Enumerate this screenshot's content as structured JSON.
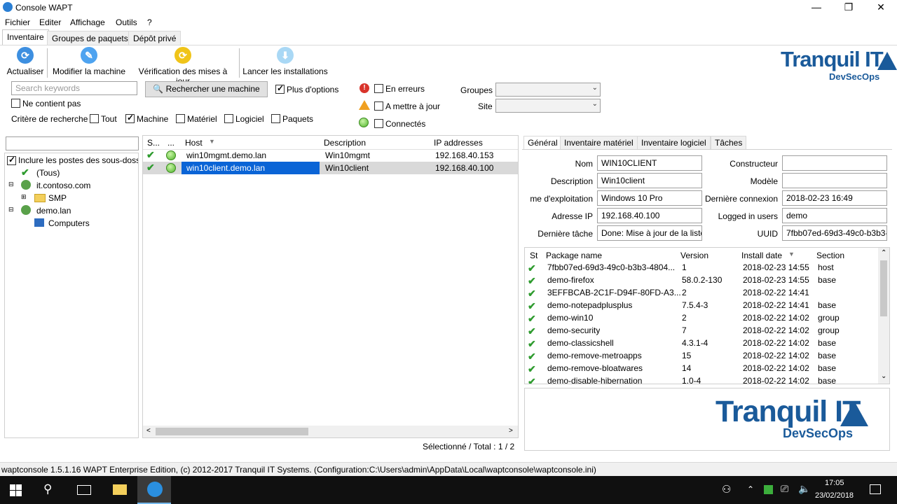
{
  "window": {
    "title": "Console WAPT"
  },
  "menu": [
    "Fichier",
    "Editer",
    "Affichage",
    "Outils",
    "?"
  ],
  "tabs": [
    "Inventaire",
    "Groupes de paquets",
    "Dépôt privé"
  ],
  "toolbar": {
    "refresh": "Actualiser",
    "edit_machine": "Modifier la machine",
    "check_updates": "Vérification des mises à jour",
    "launch_installs": "Lancer les installations"
  },
  "logo": {
    "name": "Tranquil IT",
    "tagline": "DevSecOps"
  },
  "search": {
    "placeholder": "Search keywords",
    "button": "Rechercher une machine",
    "more_options": "Plus d'options",
    "not_contains": "Ne contient pas",
    "criteria_label": "Critère de recherche",
    "criteria": [
      {
        "label": "Tout",
        "checked": false
      },
      {
        "label": "Machine",
        "checked": true
      },
      {
        "label": "Matériel",
        "checked": false
      },
      {
        "label": "Logiciel",
        "checked": false
      },
      {
        "label": "Paquets",
        "checked": false
      }
    ]
  },
  "filters": {
    "errors": "En erreurs",
    "to_update": "A mettre à jour",
    "connected": "Connectés",
    "groups_label": "Groupes",
    "site_label": "Site"
  },
  "tree": {
    "include_label": "Inclure les postes des sous-dossiers",
    "items": [
      "(Tous)",
      "it.contoso.com",
      "SMP",
      "demo.lan",
      "Computers"
    ]
  },
  "hosts": {
    "columns": [
      "S...",
      "...",
      "Host",
      "Description",
      "IP addresses"
    ],
    "rows": [
      {
        "host": "win10mgmt.demo.lan",
        "description": "Win10mgmt",
        "ip": "192.168.40.153"
      },
      {
        "host": "win10client.demo.lan",
        "description": "Win10client",
        "ip": "192.168.40.100"
      }
    ],
    "footer": "Sélectionné / Total : 1 / 2"
  },
  "detail_tabs": [
    "Général",
    "Inventaire matériel",
    "Inventaire logiciel",
    "Tâches"
  ],
  "general": {
    "nom_label": "Nom",
    "nom": "WIN10CLIENT",
    "description_label": "Description",
    "description": "Win10client",
    "os_label": "me d'exploitation",
    "os": "Windows 10 Pro",
    "ip_label": "Adresse IP",
    "ip": "192.168.40.100",
    "last_task_label": "Dernière tâche",
    "last_task": "Done: Mise à jour de la liste",
    "constructor_label": "Constructeur",
    "constructor": "",
    "model_label": "Modèle",
    "model": "",
    "last_conn_label": "Dernière connexion",
    "last_conn": "2018-02-23 16:49",
    "logged_label": "Logged in users",
    "logged": "demo",
    "uuid_label": "UUID",
    "uuid": "7fbb07ed-69d3-49c0-b3b3-"
  },
  "packages": {
    "columns": [
      "St",
      "Package name",
      "Version",
      "Install date",
      "Section"
    ],
    "rows": [
      {
        "name": "7fbb07ed-69d3-49c0-b3b3-4804...",
        "version": "1",
        "date": "2018-02-23 14:55",
        "section": "host"
      },
      {
        "name": "demo-firefox",
        "version": "58.0.2-130",
        "date": "2018-02-23 14:55",
        "section": "base"
      },
      {
        "name": "3EFFBCAB-2C1F-D94F-80FD-A3...",
        "version": "2",
        "date": "2018-02-22 14:41",
        "section": ""
      },
      {
        "name": "demo-notepadplusplus",
        "version": "7.5.4-3",
        "date": "2018-02-22 14:41",
        "section": "base"
      },
      {
        "name": "demo-win10",
        "version": "2",
        "date": "2018-02-22 14:02",
        "section": "group"
      },
      {
        "name": "demo-security",
        "version": "7",
        "date": "2018-02-22 14:02",
        "section": "group"
      },
      {
        "name": "demo-classicshell",
        "version": "4.3.1-4",
        "date": "2018-02-22 14:02",
        "section": "base"
      },
      {
        "name": "demo-remove-metroapps",
        "version": "15",
        "date": "2018-02-22 14:02",
        "section": "base"
      },
      {
        "name": "demo-remove-bloatwares",
        "version": "14",
        "date": "2018-02-22 14:02",
        "section": "base"
      },
      {
        "name": "demo-disable-hibernation",
        "version": "1.0-4",
        "date": "2018-02-22 14:02",
        "section": "base"
      }
    ]
  },
  "statusbar": "waptconsole 1.5.1.16 WAPT Enterprise Edition, (c) 2012-2017 Tranquil IT Systems. (Configuration:C:\\Users\\admin\\AppData\\Local\\waptconsole\\waptconsole.ini)",
  "taskbar": {
    "time": "17:05",
    "date": "23/02/2018"
  }
}
